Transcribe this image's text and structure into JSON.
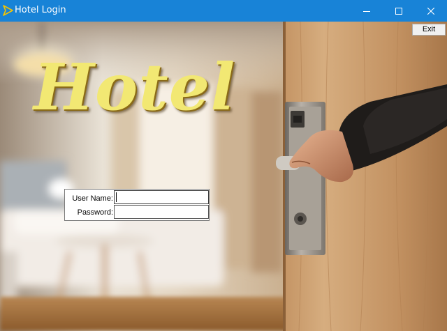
{
  "window": {
    "title": "Hotel Login",
    "accent_color": "#1883d7",
    "icon": "play-triangle-icon",
    "controls": [
      "minimize-icon",
      "maximize-icon",
      "close-icon"
    ]
  },
  "hero": {
    "title": "Hotel",
    "title_color": "#f2e873"
  },
  "toolbar": {
    "exit_label": "Exit"
  },
  "login": {
    "username_label": "User Name:",
    "username_value": "",
    "password_label": "Password:",
    "password_value": ""
  }
}
